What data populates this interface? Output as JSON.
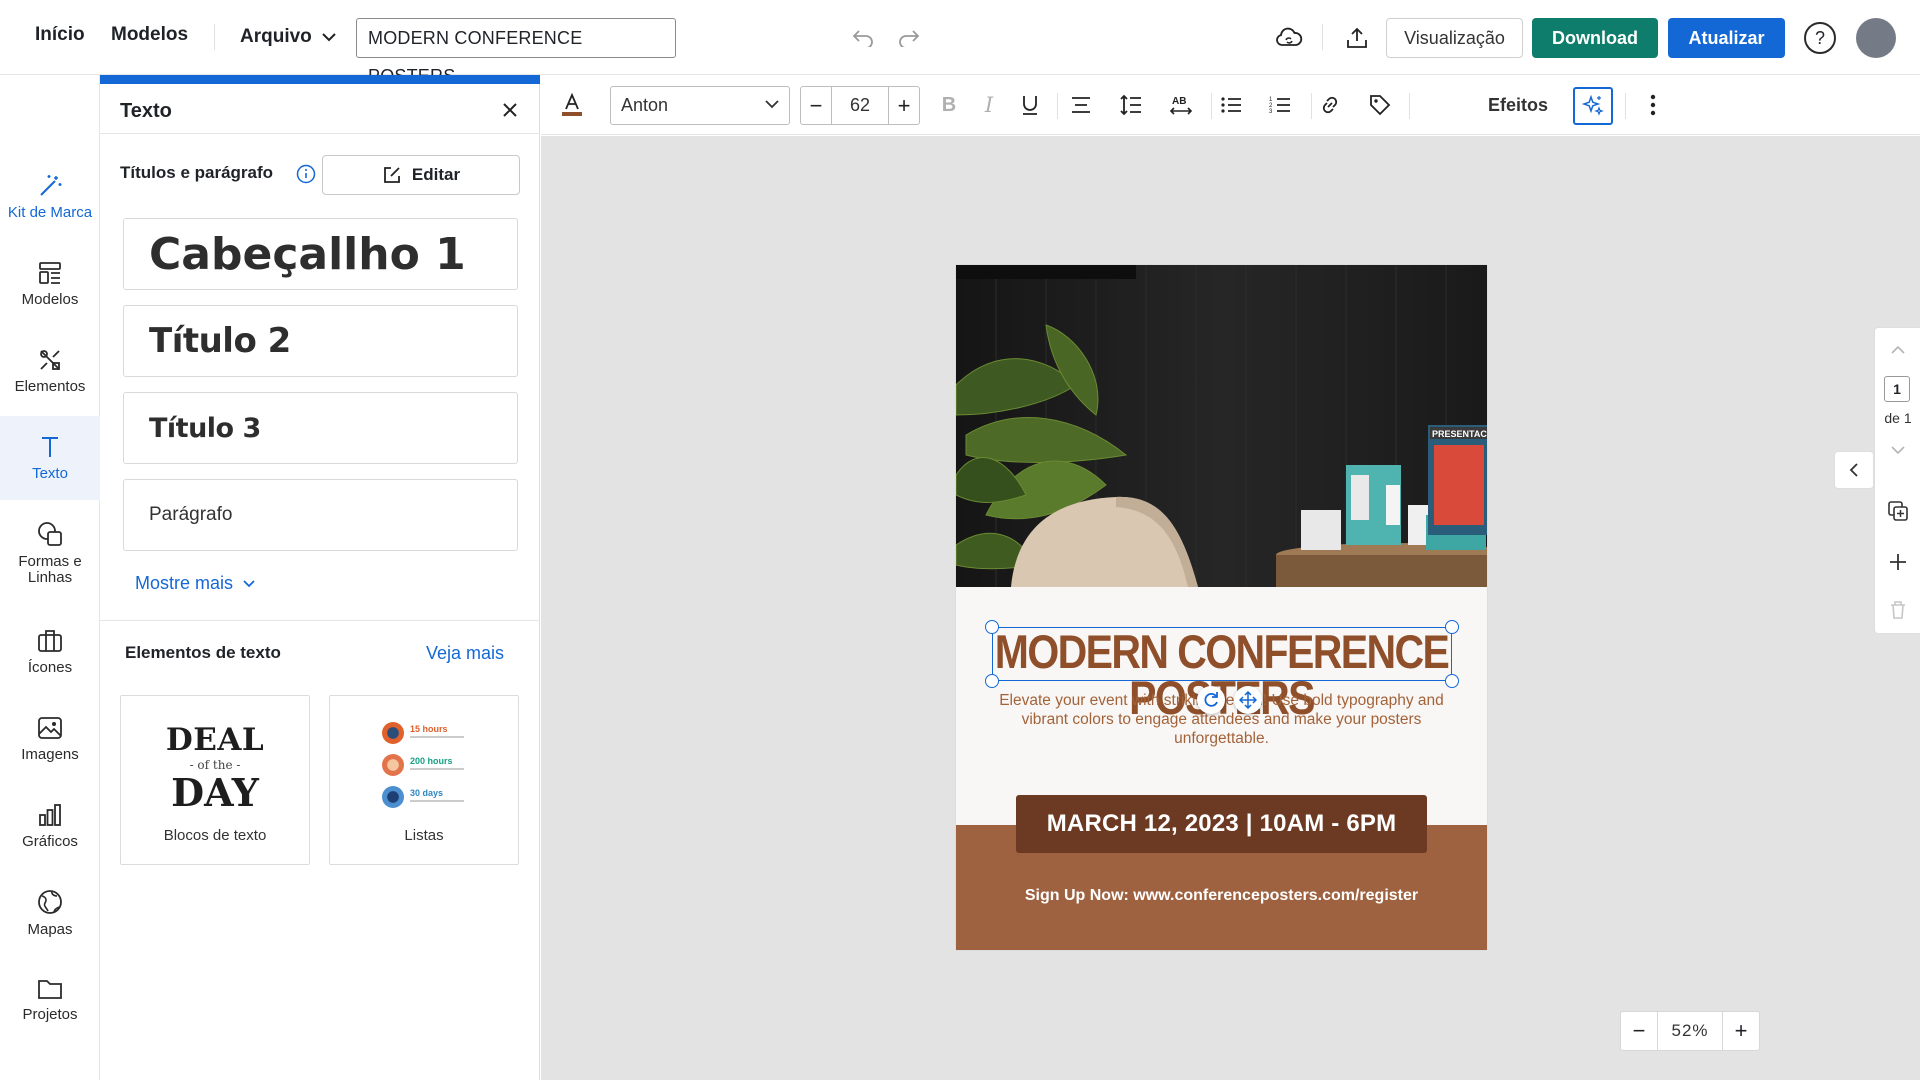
{
  "topbar": {
    "inicio": "Início",
    "modelos": "Modelos",
    "arquivo": "Arquivo",
    "document_title": "MODERN CONFERENCE POSTERS",
    "visualizacao": "Visualização",
    "download": "Download",
    "atualizar": "Atualizar",
    "help": "?"
  },
  "rail": {
    "items": [
      {
        "label": "Kit de Marca",
        "icon": "magic-wand-icon"
      },
      {
        "label": "Modelos",
        "icon": "templates-icon"
      },
      {
        "label": "Elementos",
        "icon": "elements-icon"
      },
      {
        "label": "Texto",
        "icon": "text-icon"
      },
      {
        "label": "Formas e Linhas",
        "icon": "shapes-icon"
      },
      {
        "label": "Ícones",
        "icon": "briefcase-icon"
      },
      {
        "label": "Imagens",
        "icon": "image-icon"
      },
      {
        "label": "Gráficos",
        "icon": "chart-icon"
      },
      {
        "label": "Mapas",
        "icon": "globe-icon"
      },
      {
        "label": "Projetos",
        "icon": "folder-icon"
      }
    ],
    "active": "Texto"
  },
  "panel": {
    "title": "Texto",
    "section_label": "Títulos e parágrafo",
    "edit_label": "Editar",
    "styles": {
      "h1": "Cabeçallho 1",
      "h2": "Título 2",
      "h3": "Título 3",
      "para": "Parágrafo"
    },
    "show_more": "Mostre mais",
    "elements_label": "Elementos de texto",
    "see_more": "Veja mais",
    "tiles": {
      "blocks": {
        "caption": "Blocos de texto",
        "line1": "DEAL",
        "line2": "- of the -",
        "line3": "DAY"
      },
      "lists": {
        "caption": "Listas",
        "rows": [
          {
            "text": "15 hours",
            "color": "#e0612b"
          },
          {
            "text": "200 hours",
            "color": "#16a085"
          },
          {
            "text": "30 days",
            "color": "#2e86c1"
          }
        ]
      }
    }
  },
  "toolbar": {
    "font": "Anton",
    "size": "62",
    "effects": "Efeitos",
    "text_color": "#8e4f2a"
  },
  "poster": {
    "title": "MODERN CONFERENCE POSTERS",
    "body": "Elevate your event with striking design! Use bold typography and vibrant colors to engage attendees and make your posters unforgettable.",
    "date": "MARCH 12, 2023 | 10AM - 6PM",
    "signup": "Sign Up Now: www.conferenceposters.com/register",
    "photo_sign": "PRESENTACI"
  },
  "pages": {
    "current": "1",
    "of": "de 1"
  },
  "zoom": {
    "value": "52%"
  },
  "colors": {
    "accent": "#1468d6",
    "download": "#0f7d6b",
    "poster_brown": "#9f6240",
    "poster_dark": "#6c3a22"
  }
}
